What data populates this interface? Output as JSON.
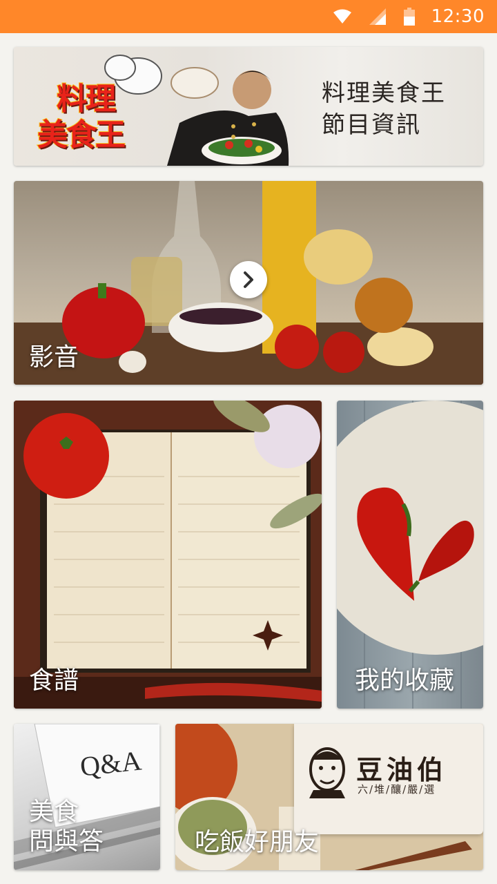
{
  "status_bar": {
    "time": "12:30",
    "icons": [
      "wifi-icon",
      "cell-signal-icon",
      "battery-icon"
    ],
    "background": "#ff8729"
  },
  "banner": {
    "logo_line1": "料理",
    "logo_line2": "美食王",
    "title_line1": "料理美食王",
    "title_line2": "節目資訊"
  },
  "tiles": {
    "video": {
      "label": "影音",
      "icon": "play-next-icon"
    },
    "recipes": {
      "label": "食譜"
    },
    "favorites": {
      "label": "我的收藏"
    },
    "qa": {
      "label_line1": "美食",
      "label_line2": "問與答",
      "card_text": "Q&A"
    },
    "friends": {
      "label": "吃飯好朋友",
      "brand_name": "豆油伯",
      "brand_sub": "六/堆/釀/嚴/選"
    }
  }
}
